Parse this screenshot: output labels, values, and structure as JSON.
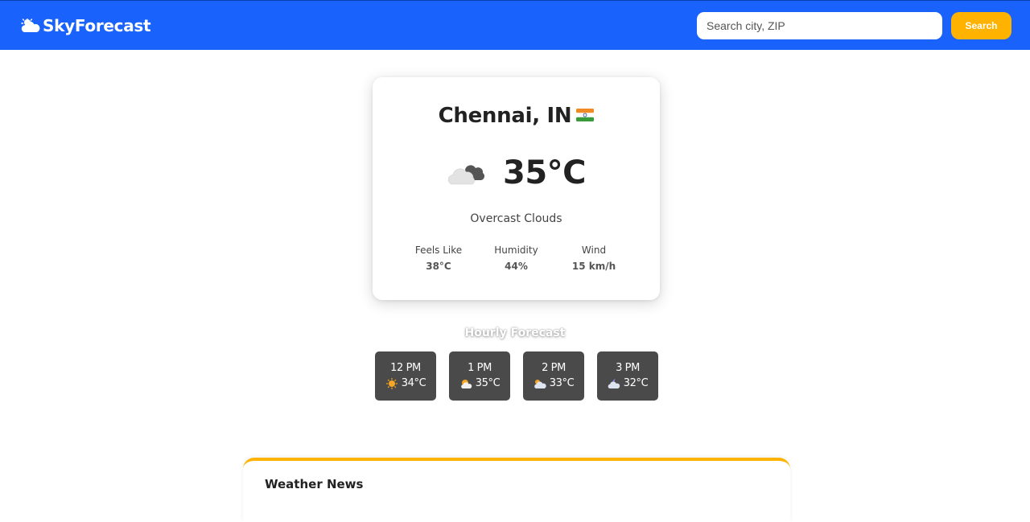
{
  "header": {
    "logo_text": "SkyForecast",
    "logo_icon": "cloud-sun-icon",
    "search_placeholder": "Search city, ZIP",
    "search_value": "",
    "search_button_label": "Search"
  },
  "current": {
    "city": "Chennai, IN",
    "flag_icon": "india-flag-icon",
    "weather_icon": "overcast-clouds-icon",
    "temperature": "35°C",
    "description": "Overcast Clouds",
    "stats": [
      {
        "label": "Feels Like",
        "value": "38°C"
      },
      {
        "label": "Humidity",
        "value": "44%"
      },
      {
        "label": "Wind",
        "value": "15 km/h"
      }
    ]
  },
  "hourly": {
    "title": "Hourly Forecast",
    "items": [
      {
        "time": "12 PM",
        "temp": "34°C",
        "icon": "sun-icon"
      },
      {
        "time": "1 PM",
        "temp": "35°C",
        "icon": "sun-cloud-icon"
      },
      {
        "time": "2 PM",
        "temp": "33°C",
        "icon": "cloud-sun-icon"
      },
      {
        "time": "3 PM",
        "temp": "32°C",
        "icon": "cloud-moon-icon"
      }
    ]
  },
  "news": {
    "title": "Weather News"
  },
  "colors": {
    "header_bg": "#1a62fc",
    "accent": "#ffb300",
    "hour_card_bg": "#4a4a4a"
  }
}
